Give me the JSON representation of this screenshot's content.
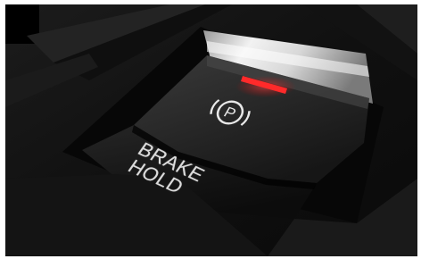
{
  "photo": {
    "subject": "car-center-console-brake-buttons",
    "parking_brake_icon": "parking-brake-icon",
    "indicator_color": "#ff2a2a",
    "button_label": {
      "line1": "BRAKE",
      "line2": "HOLD"
    }
  }
}
